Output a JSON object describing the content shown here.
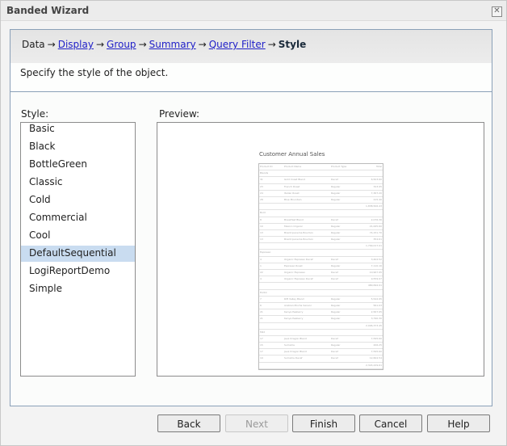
{
  "window": {
    "title": "Banded Wizard",
    "close_icon": "close-icon"
  },
  "breadcrumb": {
    "steps": [
      {
        "label": "Data",
        "link": false
      },
      {
        "label": "Display",
        "link": true
      },
      {
        "label": "Group",
        "link": true
      },
      {
        "label": "Summary",
        "link": true
      },
      {
        "label": "Query Filter",
        "link": true
      },
      {
        "label": "Style",
        "link": false,
        "current": true
      }
    ],
    "separator": "→"
  },
  "description": "Specify the style of the object.",
  "style_panel": {
    "label": "Style:",
    "items": [
      "Basic",
      "Black",
      "BottleGreen",
      "Classic",
      "Cold",
      "Commercial",
      "Cool",
      "DefaultSequential",
      "LogiReportDemo",
      "Simple"
    ],
    "selected": "DefaultSequential"
  },
  "preview_panel": {
    "label": "Preview:",
    "report_title": "Customer Annual Sales",
    "columns": [
      "Product ID",
      "Product Name",
      "Product Type",
      "Total"
    ],
    "groups": [
      {
        "name": "Blends",
        "rows": [
          [
            "31",
            "Gold Coast Blend",
            "Decaf",
            "6,503.60"
          ],
          [
            "23",
            "French Roast",
            "Regular",
            "323.95"
          ],
          [
            "24",
            "Italian Roast",
            "Regular",
            "7,367.20"
          ],
          [
            "28",
            "Blue Mountain",
            "Regular",
            "215.40"
          ]
        ],
        "total": "1,838,506.43"
      },
      {
        "name": "Bold",
        "rows": [
          [
            "8",
            "Breakfast Blend",
            "Decaf",
            "2,076.36"
          ],
          [
            "10",
            "Mexico Organic",
            "Regular",
            "21,005.60"
          ],
          [
            "13",
            "Brazil Ipanema Bourbon",
            "Regular",
            "74,151.70"
          ],
          [
            "13",
            "Brazil Ipanema Bourbon",
            "Regular",
            "354.61"
          ]
        ],
        "total": "1,799,017.91"
      },
      {
        "name": "Espresso",
        "rows": [
          [
            "4",
            "Organic Espresso Decaf",
            "Decaf",
            "3,402.52"
          ],
          [
            "1",
            "Espresso Roast",
            "Regular",
            "7,110.16"
          ],
          [
            "22",
            "Organic Espresso",
            "Decaf",
            "10,907.95"
          ],
          [
            "4",
            "Organic Espresso Decaf",
            "Decaf",
            "9,559.97"
          ]
        ],
        "total": "480,694.91"
      },
      {
        "name": "Exotic",
        "rows": [
          [
            "7",
            "Rift Valley Blend",
            "Regular",
            "5,542.95"
          ],
          [
            "6",
            "Arabian Mocha Sanani",
            "Regular",
            "561.03"
          ],
          [
            "21",
            "Kenya Peaberry",
            "Regular",
            "2,567.95"
          ],
          [
            "21",
            "Kenya Peaberry",
            "Regular",
            "3,790.30"
          ]
        ],
        "total": "2,096,373.45"
      },
      {
        "name": "Mild",
        "rows": [
          [
            "17",
            "Java Dragon Blend",
            "Decaf",
            "7,595.60"
          ],
          [
            "15",
            "Sumatra",
            "Regular",
            "206.25"
          ],
          [
            "17",
            "Java Dragon Blend",
            "Decaf",
            "7,595.60"
          ],
          [
            "19",
            "Sumatra Decaf",
            "Decaf",
            "12,604.54"
          ]
        ],
        "total": "2,324,229.61"
      }
    ]
  },
  "buttons": {
    "back": "Back",
    "next": "Next",
    "finish": "Finish",
    "cancel": "Cancel",
    "help": "Help"
  }
}
